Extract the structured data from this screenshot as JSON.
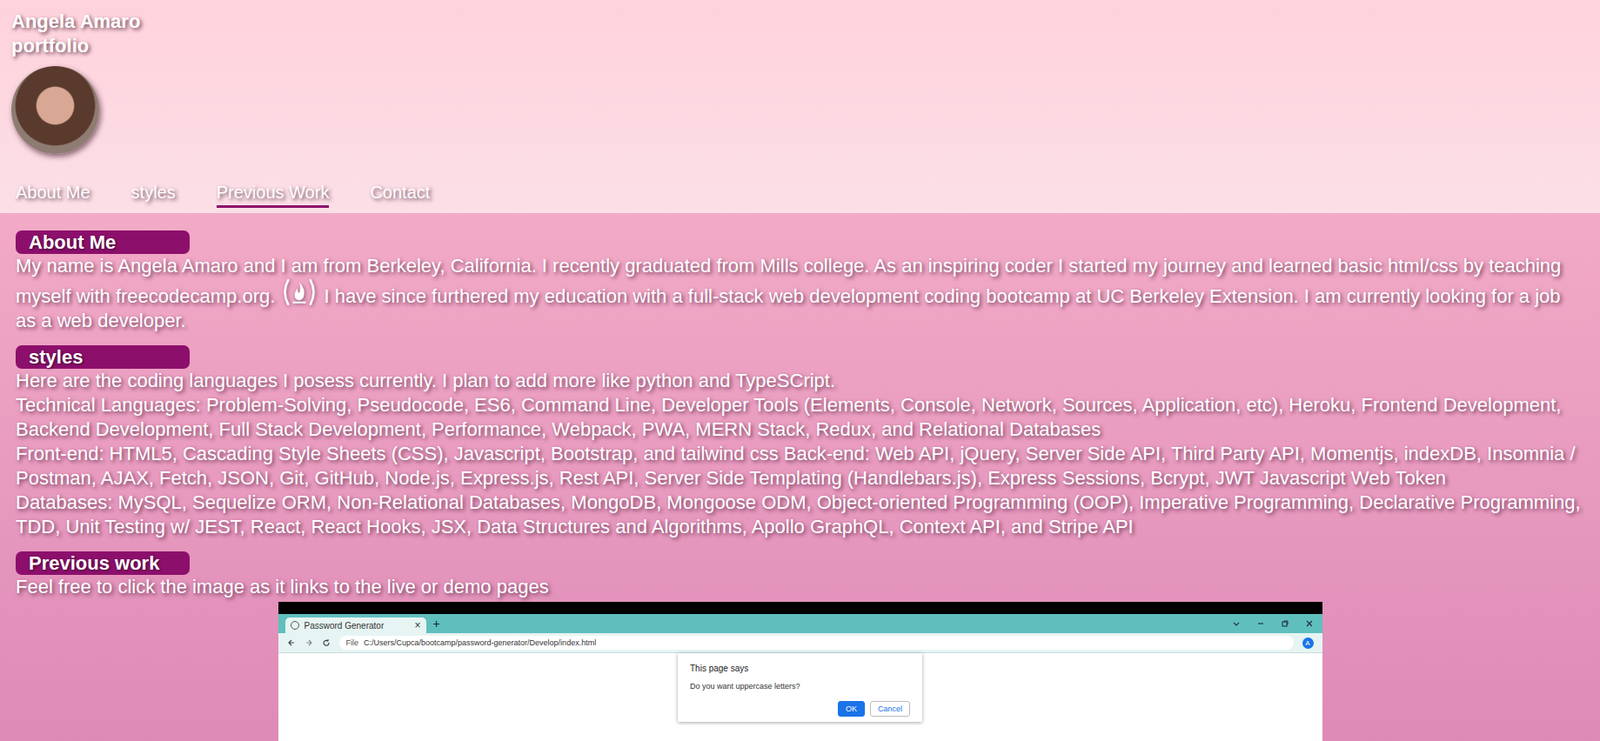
{
  "header": {
    "title": "Angela Amaro portfolio"
  },
  "nav": [
    {
      "label": "About Me",
      "selected": false
    },
    {
      "label": "styles",
      "selected": false
    },
    {
      "label": "Previous Work",
      "selected": true
    },
    {
      "label": "Contact",
      "selected": false
    }
  ],
  "about": {
    "heading": "About Me",
    "text_before_icon": "My name is Angela Amaro and I am from Berkeley, California. I recently graduated from Mills college. As an inspiring coder I started my journey and learned basic html/css by teaching myself with freecodecamp.org.",
    "text_after_icon": "I have since furthered my education with a full-stack web development coding bootcamp at UC Berkeley Extension. I am currently looking for a job as a web developer."
  },
  "styles": {
    "heading": "styles",
    "lines": [
      "Here are the coding languages I posess currently. I plan to add more like python and TypeSCript.",
      "Technical Languages: Problem-Solving, Pseudocode, ES6, Command Line, Developer Tools (Elements, Console, Network, Sources, Application, etc), Heroku, Frontend Development, Backend Development, Full Stack Development, Performance, Webpack, PWA, MERN Stack, Redux, and Relational Databases",
      "Front-end: HTML5, Cascading Style Sheets (CSS), Javascript, Bootstrap, and tailwind css Back-end: Web API, jQuery, Server Side API, Third Party API, Momentjs, indexDB, Insomnia / Postman, AJAX, Fetch, JSON, Git, GitHub, Node.js, Express.js, Rest API, Server Side Templating (Handlebars.js), Express Sessions, Bcrypt, JWT Javascript Web Token",
      "Databases: MySQL, Sequelize ORM, Non-Relational Databases, MongoDB, Mongoose ODM, Object-oriented Programming (OOP), Imperative Programming, Declarative Programming, TDD, Unit Testing w/ JEST, React, React Hooks, JSX, Data Structures and Algorithms, Apollo GraphQL, Context API, and Stripe API"
    ]
  },
  "previous_work": {
    "heading": "Previous work",
    "text": "Feel free to click the image as it links to the live or demo pages",
    "screenshot": {
      "tab_title": "Password Generator",
      "tab_close": "×",
      "new_tab": "+",
      "url_chip": "File",
      "url": "C:/Users/Cupca/bootcamp/password-generator/Develop/index.html",
      "profile": "A",
      "dialog": {
        "title": "This page says",
        "message": "Do you want uppercase letters?",
        "buttons": [
          {
            "label": "OK",
            "selected": true
          },
          {
            "label": "Cancel",
            "selected": false
          }
        ]
      }
    }
  }
}
